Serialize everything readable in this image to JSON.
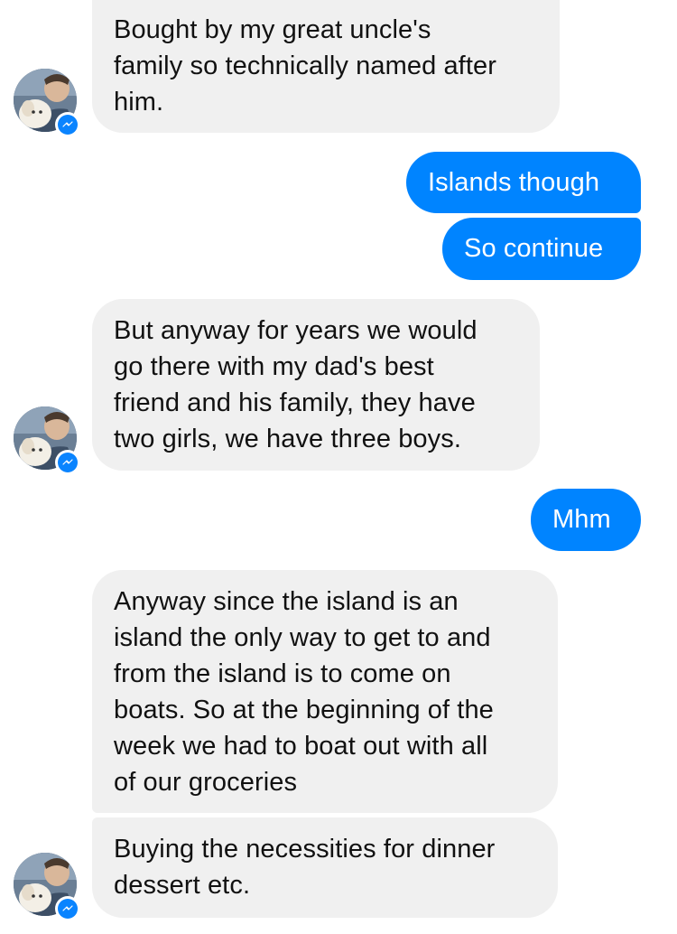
{
  "messages": [
    {
      "direction": "incoming",
      "lines": [
        "Bought by my great uncle's",
        "family so technically named after",
        "him."
      ]
    },
    {
      "direction": "outgoing",
      "text": "Islands though"
    },
    {
      "direction": "outgoing",
      "text": "So continue"
    },
    {
      "direction": "incoming",
      "lines": [
        "But anyway for years we would",
        "go there with my dad's best",
        "friend and his family, they have",
        "two girls, we have three boys."
      ]
    },
    {
      "direction": "outgoing",
      "text": "Mhm"
    },
    {
      "direction": "incoming",
      "lines": [
        "Anyway since the island is an",
        "island the only way to get to and",
        "from the island is to come on",
        "boats. So at the beginning of the",
        "week we had to boat out with all",
        "of our groceries"
      ]
    },
    {
      "direction": "incoming",
      "lines": [
        "Buying the necessities for dinner",
        "dessert etc."
      ]
    }
  ],
  "avatar": {
    "icon": "user-avatar-photo",
    "badge_icon": "messenger-badge-icon"
  },
  "colors": {
    "incoming_bg": "#f0f0f0",
    "outgoing_bg": "#0084ff",
    "badge": "#0a84ff"
  }
}
